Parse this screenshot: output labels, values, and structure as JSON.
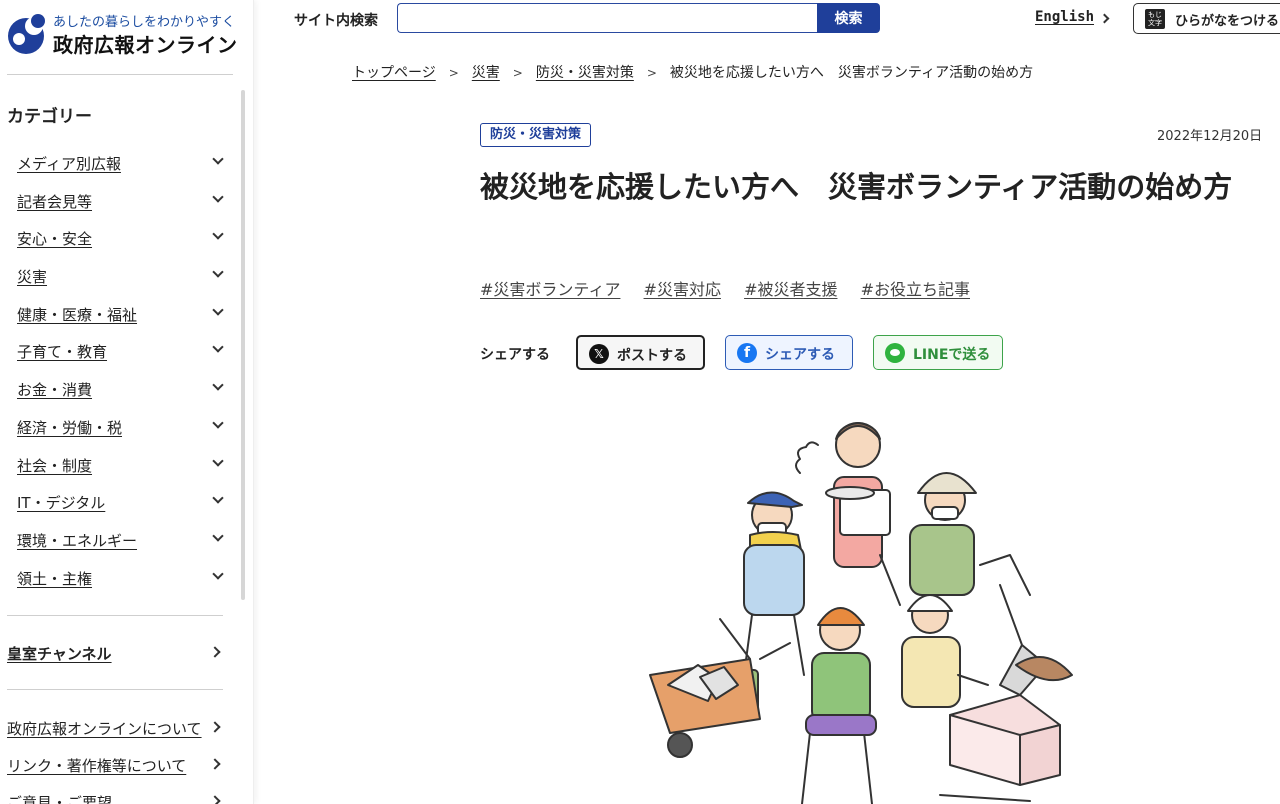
{
  "site": {
    "tagline": "あしたの暮らしをわかりやすく",
    "name": "政府広報オンライン"
  },
  "sidebar": {
    "category_title": "カテゴリー",
    "categories": [
      {
        "label": "メディア別広報"
      },
      {
        "label": "記者会見等"
      },
      {
        "label": "安心・安全"
      },
      {
        "label": "災害"
      },
      {
        "label": "健康・医療・福祉"
      },
      {
        "label": "子育て・教育"
      },
      {
        "label": "お金・消費"
      },
      {
        "label": "経済・労働・税"
      },
      {
        "label": "社会・制度"
      },
      {
        "label": "IT・デジタル"
      },
      {
        "label": "環境・エネルギー"
      },
      {
        "label": "領土・主権"
      }
    ],
    "imperial_channel": "皇室チャンネル",
    "footer_links": [
      {
        "label": "政府広報オンラインについて"
      },
      {
        "label": "リンク・著作権等について"
      },
      {
        "label": "ご意見・ご要望"
      }
    ]
  },
  "header": {
    "search_label": "サイト内検索",
    "search_value": "",
    "search_button": "検索",
    "english_link": "English",
    "furigana_icon_text": "もじ文字",
    "furigana_button": "ひらがなをつける"
  },
  "breadcrumb": [
    {
      "label": "トップページ",
      "link": true
    },
    {
      "label": "災害",
      "link": true
    },
    {
      "label": "防災・災害対策",
      "link": true
    },
    {
      "label": "被災地を応援したい方へ　災害ボランティア活動の始め方",
      "link": false
    }
  ],
  "article": {
    "category_badge": "防災・災害対策",
    "date": "2022年12月20日",
    "title": "被災地を応援したい方へ　災害ボランティア活動の始め方",
    "tags": [
      "#災害ボランティア",
      "#災害対応",
      "#被災者支援",
      "#お役立ち記事"
    ],
    "share": {
      "label": "シェアする",
      "x_button": "ポストする",
      "facebook_button": "シェアする",
      "line_button": "LINEで送る"
    }
  },
  "colors": {
    "brand_blue": "#1f3f9a",
    "facebook": "#1877f2",
    "line_green": "#2fb33e"
  }
}
